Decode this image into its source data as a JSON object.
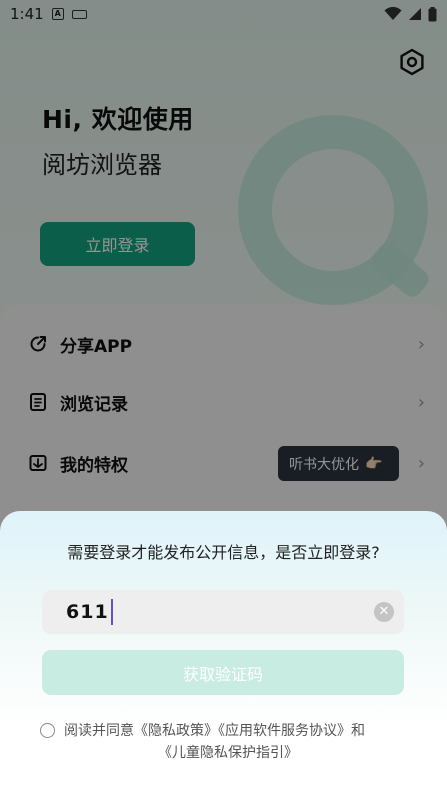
{
  "status_bar": {
    "time": "1:41",
    "notif_icon_letter": "A"
  },
  "hero": {
    "greeting": "Hi, 欢迎使用",
    "app_name": "阅坊浏览器",
    "login_button": "立即登录"
  },
  "menu": [
    {
      "label": "分享APP",
      "icon": "share-icon"
    },
    {
      "label": "浏览记录",
      "icon": "history-icon"
    },
    {
      "label": "我的特权",
      "icon": "privilege-icon"
    }
  ],
  "promo_badge": {
    "text": "听书大优化",
    "emoji": "👉🏻"
  },
  "login_sheet": {
    "title": "需要登录才能发布公开信息，是否立即登录?",
    "phone_value": "611",
    "get_code_button": "获取验证码",
    "agreement_line1": "阅读并同意《隐私政策》《应用软件服务协议》和",
    "agreement_line2": "《儿童隐私保护指引》"
  },
  "colors": {
    "brand_green": "#14a37e",
    "code_button_disabled": "#c9ece2",
    "caret": "#6c4cc7"
  }
}
